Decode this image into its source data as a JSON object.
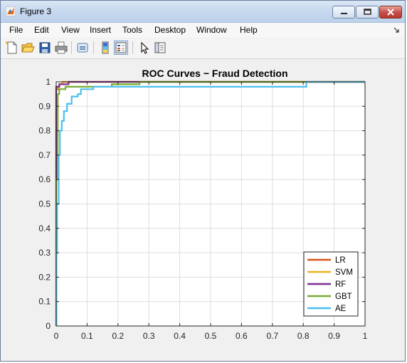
{
  "window": {
    "title": "Figure 3",
    "colors": {
      "titlebar": "#c6d8ee",
      "close_button": "#c75050"
    }
  },
  "menu": {
    "items": [
      "File",
      "Edit",
      "View",
      "Insert",
      "Tools",
      "Desktop",
      "Window",
      "Help"
    ]
  },
  "toolbar": {
    "icons": [
      "new-figure-icon",
      "open-file-icon",
      "save-icon",
      "print-icon",
      "link-icon",
      "colorbar-icon",
      "legend-icon",
      "pointer-icon",
      "property-editor-icon"
    ]
  },
  "chart_data": {
    "type": "line",
    "title": "ROC Curves − Fraud Detection",
    "xlabel": "",
    "ylabel": "",
    "xlim": [
      0,
      1
    ],
    "ylim": [
      0,
      1
    ],
    "x_ticks": [
      "0",
      "0.1",
      "0.2",
      "0.3",
      "0.4",
      "0.5",
      "0.6",
      "0.7",
      "0.8",
      "0.9",
      "1"
    ],
    "y_ticks": [
      "0",
      "0.1",
      "0.2",
      "0.3",
      "0.4",
      "0.5",
      "0.6",
      "0.7",
      "0.8",
      "0.9",
      "1"
    ],
    "grid": true,
    "legend_position": "bottom-right",
    "series": [
      {
        "name": "LR",
        "color": "#d95319",
        "x": [
          0,
          0,
          0.005,
          0.005,
          0.01,
          0.01,
          0.02,
          0.02,
          0.03,
          0.03,
          1
        ],
        "y": [
          0,
          0.97,
          0.97,
          0.98,
          0.98,
          0.99,
          0.99,
          1.0,
          1.0,
          1.0,
          1.0
        ]
      },
      {
        "name": "SVM",
        "color": "#edb120",
        "x": [
          0,
          0,
          0.01,
          0.01,
          0.02,
          0.02,
          1
        ],
        "y": [
          0,
          0.975,
          0.975,
          0.99,
          0.99,
          1.0,
          1.0
        ]
      },
      {
        "name": "RF",
        "color": "#7e2f8e",
        "x": [
          0,
          0,
          0.01,
          0.01,
          0.04,
          0.04,
          0.27,
          1
        ],
        "y": [
          0,
          0.98,
          0.98,
          0.99,
          0.99,
          1.0,
          1.0,
          1.0
        ]
      },
      {
        "name": "GBT",
        "color": "#77ac30",
        "x": [
          0,
          0,
          0.005,
          0.005,
          0.01,
          0.01,
          0.03,
          0.03,
          0.18,
          0.18,
          0.27,
          0.27,
          1
        ],
        "y": [
          0,
          0.6,
          0.6,
          0.95,
          0.95,
          0.97,
          0.97,
          0.98,
          0.98,
          0.99,
          0.99,
          1.0,
          1.0
        ]
      },
      {
        "name": "AE",
        "color": "#4dbeee",
        "x": [
          0,
          0,
          0.003,
          0.003,
          0.008,
          0.008,
          0.012,
          0.012,
          0.018,
          0.018,
          0.025,
          0.025,
          0.035,
          0.035,
          0.05,
          0.05,
          0.07,
          0.07,
          0.08,
          0.08,
          0.12,
          0.12,
          0.81,
          0.81,
          1
        ],
        "y": [
          0,
          0.3,
          0.3,
          0.5,
          0.5,
          0.7,
          0.7,
          0.8,
          0.8,
          0.84,
          0.84,
          0.88,
          0.88,
          0.91,
          0.91,
          0.94,
          0.94,
          0.95,
          0.95,
          0.97,
          0.97,
          0.98,
          0.98,
          1.0,
          1.0
        ]
      }
    ]
  }
}
